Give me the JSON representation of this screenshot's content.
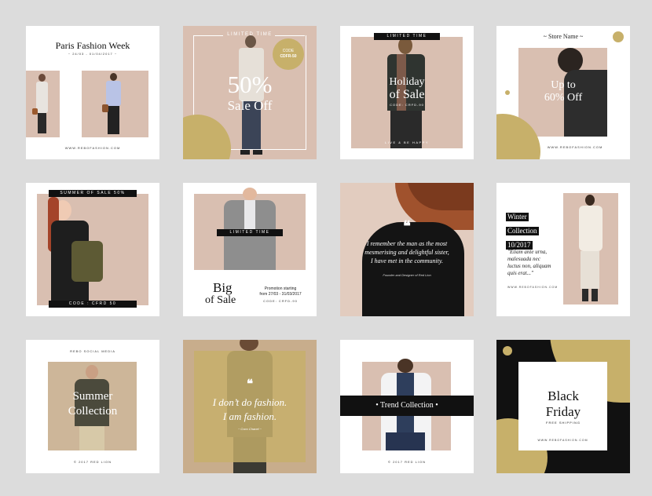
{
  "colors": {
    "page_bg": "#dcdcdc",
    "gold": "#c7b06a",
    "blush": "#d9bfb1",
    "black": "#111111",
    "white": "#ffffff"
  },
  "cards": {
    "paris": {
      "title": "Paris Fashion Week",
      "dates": "~ 24/03 - 01/04/2017 ~",
      "url": "WWW.REBOFASHION.COM"
    },
    "sale50": {
      "top": "LIMITED TIME",
      "code_label": "CODE",
      "code": "CDFR-50",
      "percent": "50%",
      "sale": "Sale Off"
    },
    "holiday": {
      "top": "LIMITED TIME",
      "title_line1": "Holiday",
      "title_line2": "of Sale",
      "code": "CODE: CRFD-90",
      "footer": "LIVE & BE HAPPY"
    },
    "store": {
      "name": "~ Store Name ~",
      "line1": "Up to",
      "line2": "60% Off",
      "url": "WWW.REBOFASHION.COM"
    },
    "summer_sale": {
      "top": "SUMMER OF SALE 50%",
      "code": "CODE : CFRD 50"
    },
    "big_sale": {
      "limited": "LIMITED TIME",
      "big": "Big",
      "of_sale": "of Sale",
      "promo1": "Promotion starting",
      "promo2": "from 27/03 - 31/03/2017",
      "code": "CODE: CRFD-90"
    },
    "quote": {
      "line1": "I remember the man as the most",
      "line2": "mesmerising and delightful sister,",
      "line3": "I have met in the community.",
      "author": "Founder and Designer of Red Lion"
    },
    "winter": {
      "line1": "Winter",
      "line2": "Collection",
      "line3": "10/2017",
      "q1": "\"Etiam ante urna,",
      "q2": "malesuada nec",
      "q3": "luctus non, aliquam",
      "q4": "quis erat...\"",
      "url": "WWW.REBOFASHION.COM"
    },
    "summer_collection": {
      "top": "REBO SOCIAL MEDIA",
      "line1": "Summer",
      "line2": "Collection",
      "footer": "© 2017 RED LION"
    },
    "dont_do": {
      "line1": "I don’t do fashion.",
      "line2": "I am fashion.",
      "author": "~ Coco Chanel ~"
    },
    "trend": {
      "label": "• Trend Collection •",
      "footer": "© 2017 RED LION"
    },
    "black_friday": {
      "line1": "Black",
      "line2": "Friday",
      "free": "FREE SHIPPING",
      "url": "WWW.REBOFASHION.COM"
    }
  }
}
